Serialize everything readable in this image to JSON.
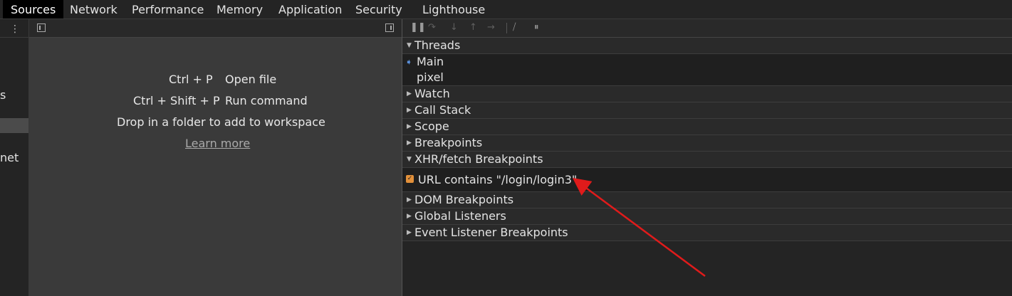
{
  "tabs": [
    {
      "label": "Sources",
      "active": true
    },
    {
      "label": "Network"
    },
    {
      "label": "Performance"
    },
    {
      "label": "Memory"
    },
    {
      "label": "Application"
    },
    {
      "label": "Security"
    },
    {
      "label": "Lighthouse"
    }
  ],
  "sidebar": {
    "kebab_icon": "more-vert-icon",
    "partial_labels": [
      "s",
      "net"
    ]
  },
  "editor": {
    "shortcuts": [
      {
        "keys": "Ctrl + P",
        "action": "Open file"
      },
      {
        "keys": "Ctrl + Shift + P",
        "action": "Run command"
      }
    ],
    "drop_hint": "Drop in a folder to add to workspace",
    "learn_more": "Learn more"
  },
  "debugger": {
    "toolbar_icons": [
      "pause-icon",
      "step-over-icon",
      "step-into-icon",
      "step-out-icon",
      "step-icon",
      "deactivate-breakpoints-icon",
      "pause-on-exceptions-icon"
    ],
    "sections": {
      "threads": "Threads",
      "thread_items": [
        "Main",
        "pixel"
      ],
      "watch": "Watch",
      "call_stack": "Call Stack",
      "scope": "Scope",
      "breakpoints": "Breakpoints",
      "xhr": "XHR/fetch Breakpoints",
      "xhr_item": "URL contains \"/login/login3\"",
      "dom": "DOM Breakpoints",
      "global": "Global Listeners",
      "event": "Event Listener Breakpoints"
    }
  },
  "annotation": {
    "color": "#e01b1b"
  }
}
